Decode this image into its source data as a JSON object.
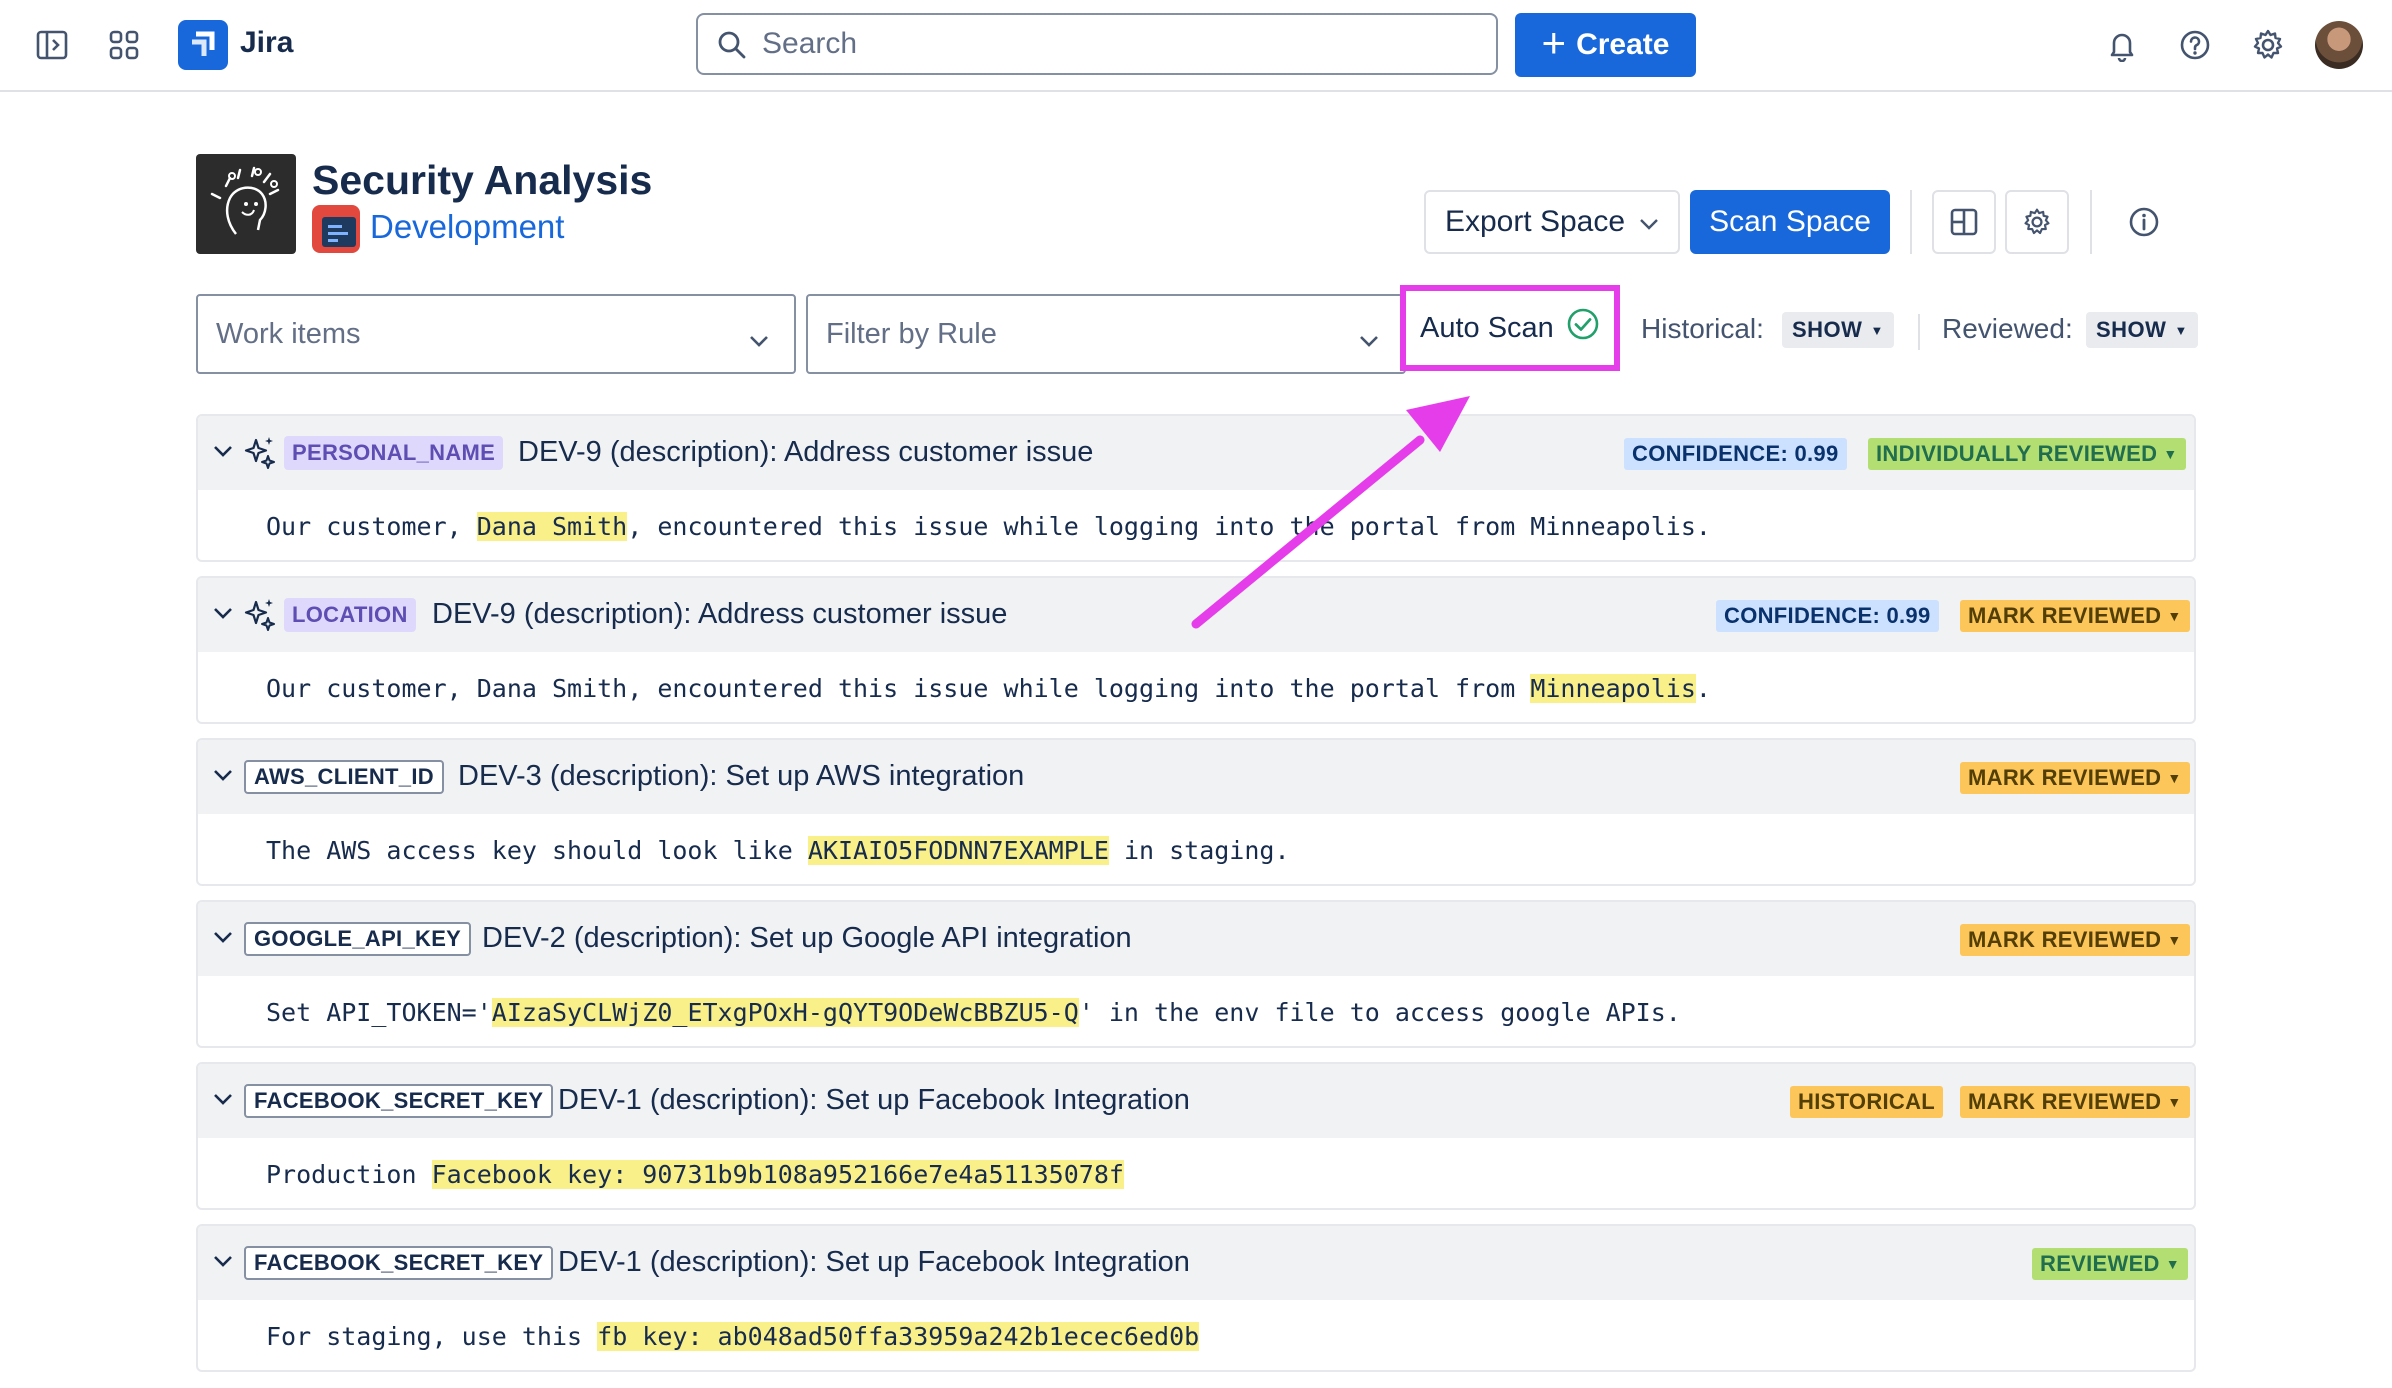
{
  "topbar": {
    "app_name": "Jira",
    "search_placeholder": "Search",
    "create_label": "Create"
  },
  "project": {
    "title": "Security Analysis",
    "space_name": "Development"
  },
  "actions": {
    "export_label": "Export Space",
    "scan_label": "Scan Space"
  },
  "filters": {
    "work_items_placeholder": "Work items",
    "rule_placeholder": "Filter by Rule",
    "auto_scan_label": "Auto Scan",
    "historical_label": "Historical:",
    "historical_value": "SHOW",
    "reviewed_label": "Reviewed:",
    "reviewed_value": "SHOW"
  },
  "colors": {
    "brand": "#1868DB",
    "highlight_box": "#E63DEB",
    "match_highlight": "#FAF08A"
  },
  "findings": [
    {
      "tag": "PERSONAL_NAME",
      "ai_detected": true,
      "title": "DEV-9 (description): Address customer issue",
      "confidence": "CONFIDENCE: 0.99",
      "status": "INDIVIDUALLY REVIEWED",
      "body_pre": "Our customer, ",
      "body_match": "Dana Smith",
      "body_post": ", encountered this issue while logging into the portal from Minneapolis."
    },
    {
      "tag": "LOCATION",
      "ai_detected": true,
      "title": "DEV-9 (description): Address customer issue",
      "confidence": "CONFIDENCE: 0.99",
      "status": "MARK REVIEWED",
      "body_pre": "Our customer, Dana Smith, encountered this issue while logging into the portal from ",
      "body_match": "Minneapolis",
      "body_post": "."
    },
    {
      "tag": "AWS_CLIENT_ID",
      "ai_detected": false,
      "title": "DEV-3 (description): Set up AWS integration",
      "status": "MARK REVIEWED",
      "body_pre": "The AWS access key should look like ",
      "body_match": "AKIAIO5FODNN7EXAMPLE",
      "body_post": " in staging."
    },
    {
      "tag": "GOOGLE_API_KEY",
      "ai_detected": false,
      "title": "DEV-2 (description): Set up Google API integration",
      "status": "MARK REVIEWED",
      "body_pre": "Set API_TOKEN='",
      "body_match": "AIzaSyCLWjZ0_ETxgPOxH-gQYT9ODeWcBBZU5-Q",
      "body_post": "' in the env file to access google APIs."
    },
    {
      "tag": "FACEBOOK_SECRET_KEY",
      "ai_detected": false,
      "title": "DEV-1 (description): Set up Facebook Integration",
      "historical": "HISTORICAL",
      "status": "MARK REVIEWED",
      "body_pre": "Production ",
      "body_match": "Facebook key: 90731b9b108a952166e7e4a51135078f",
      "body_post": ""
    },
    {
      "tag": "FACEBOOK_SECRET_KEY",
      "ai_detected": false,
      "title": "DEV-1 (description): Set up Facebook Integration",
      "status": "REVIEWED",
      "body_pre": "For staging, use this ",
      "body_match": "fb key: ab048ad50ffa33959a242b1ecec6ed0b",
      "body_post": ""
    }
  ]
}
